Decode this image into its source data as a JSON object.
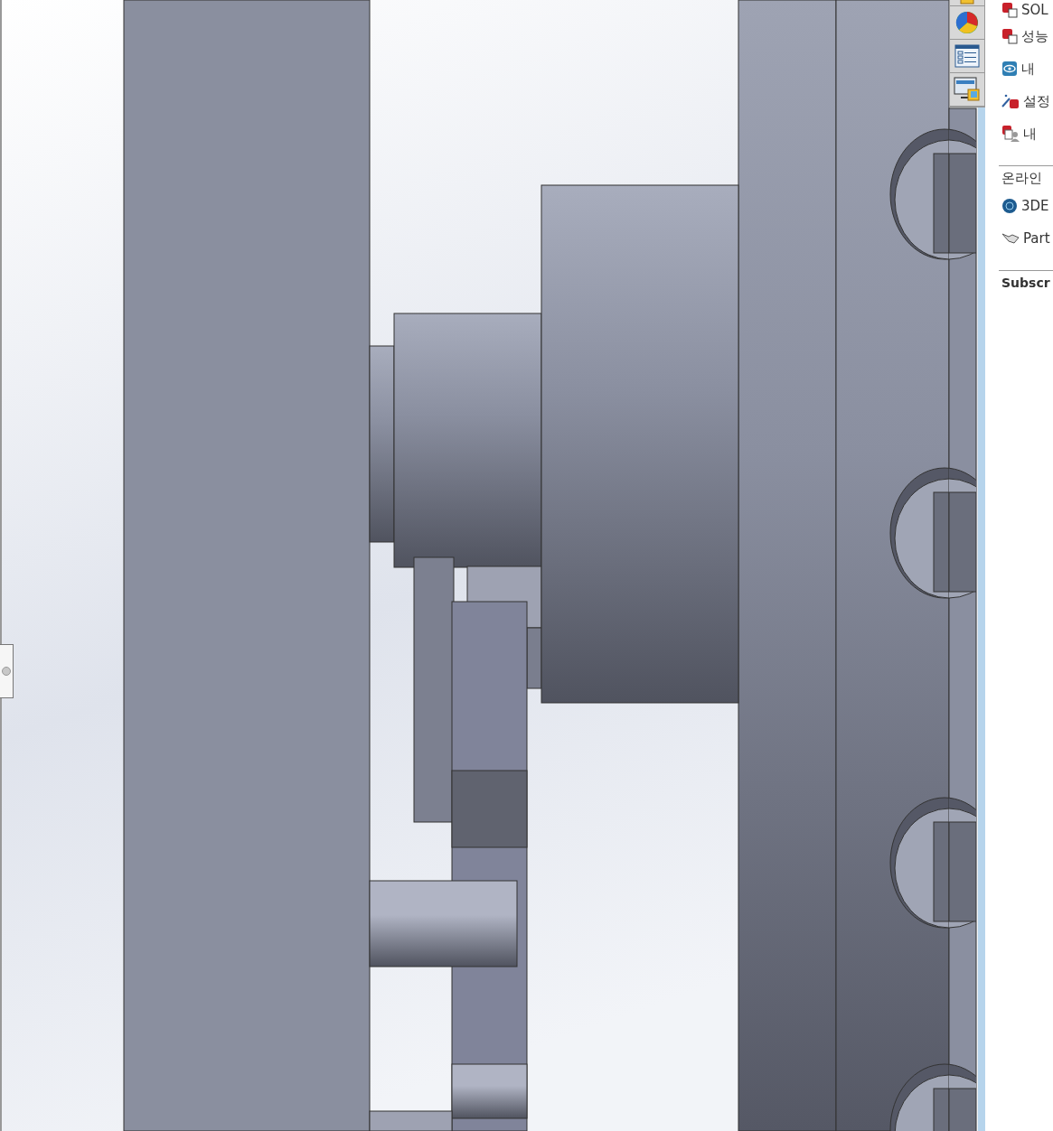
{
  "task_pane": {
    "resources": [
      {
        "label": "SOL",
        "kind": "box"
      },
      {
        "label": "성능",
        "kind": "box"
      },
      {
        "label": "내",
        "kind": "eye"
      },
      {
        "label": "설정",
        "kind": "wand"
      },
      {
        "label": "내",
        "kind": "person"
      }
    ],
    "online_title": "온라인",
    "online": [
      {
        "label": "3DE",
        "kind": "globe"
      },
      {
        "label": "Part",
        "kind": "hand"
      }
    ],
    "subscription_title": "Subscr"
  }
}
